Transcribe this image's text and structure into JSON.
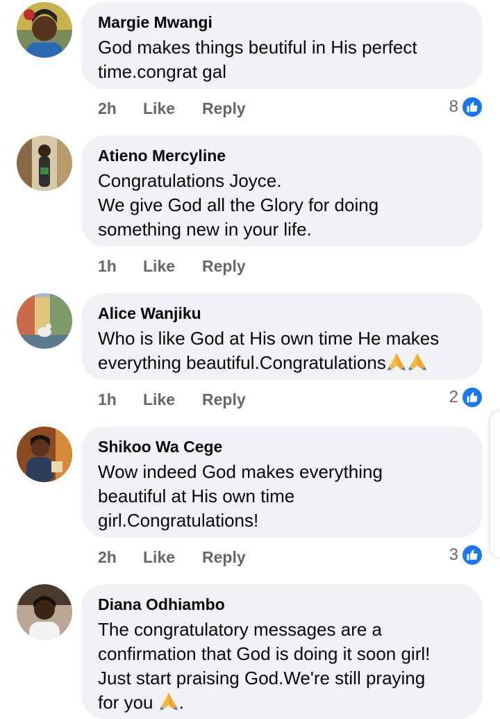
{
  "comments": [
    {
      "author": "Margie Mwangi",
      "text": "God makes things beutiful in His perfect\ntime.congrat gal",
      "time": "2h",
      "like_label": "Like",
      "reply_label": "Reply",
      "reaction_count": "8",
      "avatar_icon": "profile-photo"
    },
    {
      "author": "Atieno Mercyline",
      "text": "Congratulations Joyce.\nWe give God all the Glory for doing\nsomething new in your life.",
      "time": "1h",
      "like_label": "Like",
      "reply_label": "Reply",
      "reaction_count": "",
      "avatar_icon": "profile-photo"
    },
    {
      "author": "Alice Wanjiku",
      "text": "Who is like God at His own time He makes\neverything beautiful.Congratulations",
      "emoji": "🙏🙏",
      "time": "1h",
      "like_label": "Like",
      "reply_label": "Reply",
      "reaction_count": "2",
      "avatar_icon": "profile-photo"
    },
    {
      "author": "Shikoo Wa Cege",
      "text": "Wow indeed God makes everything\nbeautiful at His own time\ngirl.Congratulations!",
      "time": "2h",
      "like_label": "Like",
      "reply_label": "Reply",
      "reaction_count": "3",
      "avatar_icon": "profile-photo"
    },
    {
      "author": "Diana Odhiambo",
      "text": "The congratulatory messages are a\nconfirmation that God is doing it soon girl!\nJust start praising God.We're still praying\nfor you ",
      "emoji": "🙏",
      "emoji_suffix": ".",
      "time": "",
      "like_label": "",
      "reply_label": "",
      "reaction_count": "",
      "avatar_icon": "profile-photo"
    }
  ],
  "colors": {
    "bubble": "#f0f2f5",
    "secondary_text": "#65676b",
    "like_blue": "#1877f2",
    "emoji_yellow": "#f6b93b"
  },
  "icons": {
    "like": "thumbs-up-icon",
    "pray": "folded-hands-emoji"
  }
}
